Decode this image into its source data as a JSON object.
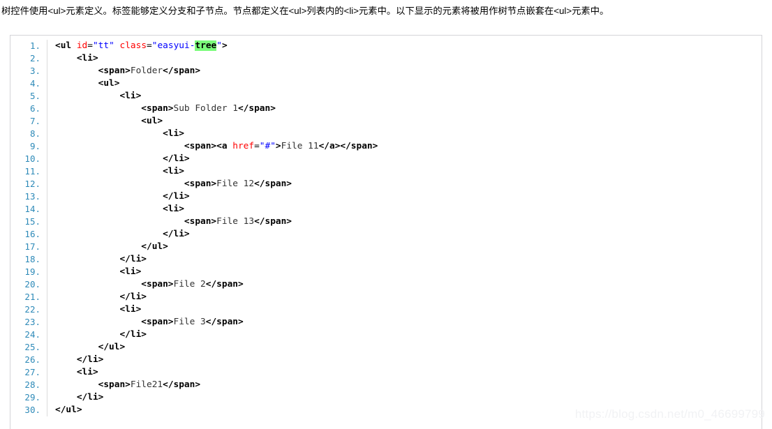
{
  "page": {
    "intro_paragraph": "树控件使用<ul>元素定义。标签能够定义分支和子节点。节点都定义在<ul>列表内的<li>元素中。以下显示的元素将被用作树节点嵌套在<ul>元素中。",
    "watermark": "https://blog.csdn.net/m0_46699799"
  },
  "colors": {
    "tag": "#000000",
    "attribute_name": "#ff0000",
    "attribute_value": "#0000ff",
    "line_number": "#2e8ab8",
    "highlight_background": "#7cfc7c",
    "code_border": "#d4d4d8",
    "gutter_divider": "#dcdcdc",
    "watermark": "#f1f2f4",
    "page_background": "#ffffff"
  },
  "code_block": {
    "language": "html",
    "line_count": 30,
    "highlighted_token": "tree",
    "lines": [
      {
        "n": "1.",
        "indent": 0,
        "tokens": [
          {
            "t": "tag",
            "v": "<ul "
          },
          {
            "t": "attr",
            "v": "id"
          },
          {
            "t": "eq",
            "v": "="
          },
          {
            "t": "val",
            "v": "\"tt\""
          },
          {
            "t": "tag",
            "v": " "
          },
          {
            "t": "attr",
            "v": "class"
          },
          {
            "t": "eq",
            "v": "="
          },
          {
            "t": "val",
            "v": "\"easyui-"
          },
          {
            "t": "hl",
            "v": "tree"
          },
          {
            "t": "val",
            "v": "\""
          },
          {
            "t": "tag",
            "v": ">"
          }
        ]
      },
      {
        "n": "2.",
        "indent": 1,
        "tokens": [
          {
            "t": "tag",
            "v": "<li>"
          }
        ]
      },
      {
        "n": "3.",
        "indent": 2,
        "tokens": [
          {
            "t": "tag",
            "v": "<span>"
          },
          {
            "t": "text",
            "v": "Folder"
          },
          {
            "t": "tag",
            "v": "</span>"
          }
        ]
      },
      {
        "n": "4.",
        "indent": 2,
        "tokens": [
          {
            "t": "tag",
            "v": "<ul>"
          }
        ]
      },
      {
        "n": "5.",
        "indent": 3,
        "tokens": [
          {
            "t": "tag",
            "v": "<li>"
          }
        ]
      },
      {
        "n": "6.",
        "indent": 4,
        "tokens": [
          {
            "t": "tag",
            "v": "<span>"
          },
          {
            "t": "text",
            "v": "Sub Folder 1"
          },
          {
            "t": "tag",
            "v": "</span>"
          }
        ]
      },
      {
        "n": "7.",
        "indent": 4,
        "tokens": [
          {
            "t": "tag",
            "v": "<ul>"
          }
        ]
      },
      {
        "n": "8.",
        "indent": 5,
        "tokens": [
          {
            "t": "tag",
            "v": "<li>"
          }
        ]
      },
      {
        "n": "9.",
        "indent": 6,
        "tokens": [
          {
            "t": "tag",
            "v": "<span><a "
          },
          {
            "t": "attr",
            "v": "href"
          },
          {
            "t": "eq",
            "v": "="
          },
          {
            "t": "val",
            "v": "\"#\""
          },
          {
            "t": "tag",
            "v": ">"
          },
          {
            "t": "text",
            "v": "File 11"
          },
          {
            "t": "tag",
            "v": "</a></span>"
          }
        ]
      },
      {
        "n": "10.",
        "indent": 5,
        "tokens": [
          {
            "t": "tag",
            "v": "</li>"
          }
        ]
      },
      {
        "n": "11.",
        "indent": 5,
        "tokens": [
          {
            "t": "tag",
            "v": "<li>"
          }
        ]
      },
      {
        "n": "12.",
        "indent": 6,
        "tokens": [
          {
            "t": "tag",
            "v": "<span>"
          },
          {
            "t": "text",
            "v": "File 12"
          },
          {
            "t": "tag",
            "v": "</span>"
          }
        ]
      },
      {
        "n": "13.",
        "indent": 5,
        "tokens": [
          {
            "t": "tag",
            "v": "</li>"
          }
        ]
      },
      {
        "n": "14.",
        "indent": 5,
        "tokens": [
          {
            "t": "tag",
            "v": "<li>"
          }
        ]
      },
      {
        "n": "15.",
        "indent": 6,
        "tokens": [
          {
            "t": "tag",
            "v": "<span>"
          },
          {
            "t": "text",
            "v": "File 13"
          },
          {
            "t": "tag",
            "v": "</span>"
          }
        ]
      },
      {
        "n": "16.",
        "indent": 5,
        "tokens": [
          {
            "t": "tag",
            "v": "</li>"
          }
        ]
      },
      {
        "n": "17.",
        "indent": 4,
        "tokens": [
          {
            "t": "tag",
            "v": "</ul>"
          }
        ]
      },
      {
        "n": "18.",
        "indent": 3,
        "tokens": [
          {
            "t": "tag",
            "v": "</li>"
          }
        ]
      },
      {
        "n": "19.",
        "indent": 3,
        "tokens": [
          {
            "t": "tag",
            "v": "<li>"
          }
        ]
      },
      {
        "n": "20.",
        "indent": 4,
        "tokens": [
          {
            "t": "tag",
            "v": "<span>"
          },
          {
            "t": "text",
            "v": "File 2"
          },
          {
            "t": "tag",
            "v": "</span>"
          }
        ]
      },
      {
        "n": "21.",
        "indent": 3,
        "tokens": [
          {
            "t": "tag",
            "v": "</li>"
          }
        ]
      },
      {
        "n": "22.",
        "indent": 3,
        "tokens": [
          {
            "t": "tag",
            "v": "<li>"
          }
        ]
      },
      {
        "n": "23.",
        "indent": 4,
        "tokens": [
          {
            "t": "tag",
            "v": "<span>"
          },
          {
            "t": "text",
            "v": "File 3"
          },
          {
            "t": "tag",
            "v": "</span>"
          }
        ]
      },
      {
        "n": "24.",
        "indent": 3,
        "tokens": [
          {
            "t": "tag",
            "v": "</li>"
          }
        ]
      },
      {
        "n": "25.",
        "indent": 2,
        "tokens": [
          {
            "t": "tag",
            "v": "</ul>"
          }
        ]
      },
      {
        "n": "26.",
        "indent": 1,
        "tokens": [
          {
            "t": "tag",
            "v": "</li>"
          }
        ]
      },
      {
        "n": "27.",
        "indent": 1,
        "tokens": [
          {
            "t": "tag",
            "v": "<li>"
          }
        ]
      },
      {
        "n": "28.",
        "indent": 2,
        "tokens": [
          {
            "t": "tag",
            "v": "<span>"
          },
          {
            "t": "text",
            "v": "File21"
          },
          {
            "t": "tag",
            "v": "</span>"
          }
        ]
      },
      {
        "n": "29.",
        "indent": 1,
        "tokens": [
          {
            "t": "tag",
            "v": "</li>"
          }
        ]
      },
      {
        "n": "30.",
        "indent": 0,
        "tokens": [
          {
            "t": "tag",
            "v": "</ul>"
          }
        ]
      }
    ]
  }
}
